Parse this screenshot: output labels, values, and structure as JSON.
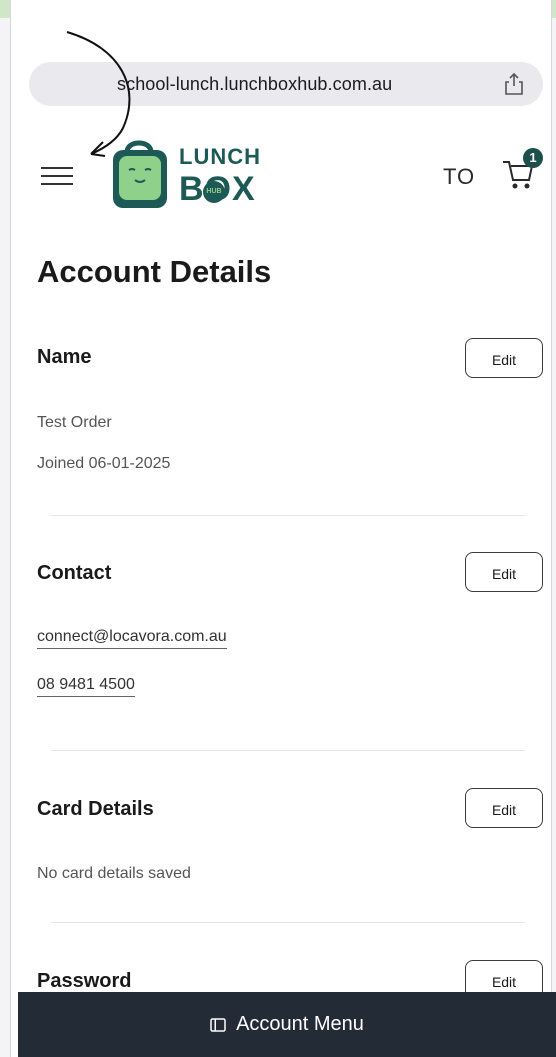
{
  "browser": {
    "url": "school-lunch.lunchboxhub.com.au"
  },
  "header": {
    "logo_line1": "LUNCH",
    "logo_line2": "BOX",
    "logo_badge": "HUB",
    "user_initials": "TO",
    "cart_count": "1"
  },
  "page": {
    "title": "Account Details"
  },
  "sections": {
    "name": {
      "heading": "Name",
      "edit_label": "Edit",
      "full_name": "Test Order",
      "joined": "Joined 06-01-2025"
    },
    "contact": {
      "heading": "Contact",
      "edit_label": "Edit",
      "email": "connect@locavora.com.au",
      "phone": "08 9481 4500"
    },
    "card": {
      "heading": "Card Details",
      "edit_label": "Edit",
      "status": "No card details saved"
    },
    "password": {
      "heading": "Password",
      "edit_label": "Edit"
    }
  },
  "bottom_bar": {
    "label": "Account Menu"
  },
  "colors": {
    "brand_teal": "#1d5a55",
    "brand_green": "#8fd08a",
    "bottom_bar": "#232b36"
  }
}
